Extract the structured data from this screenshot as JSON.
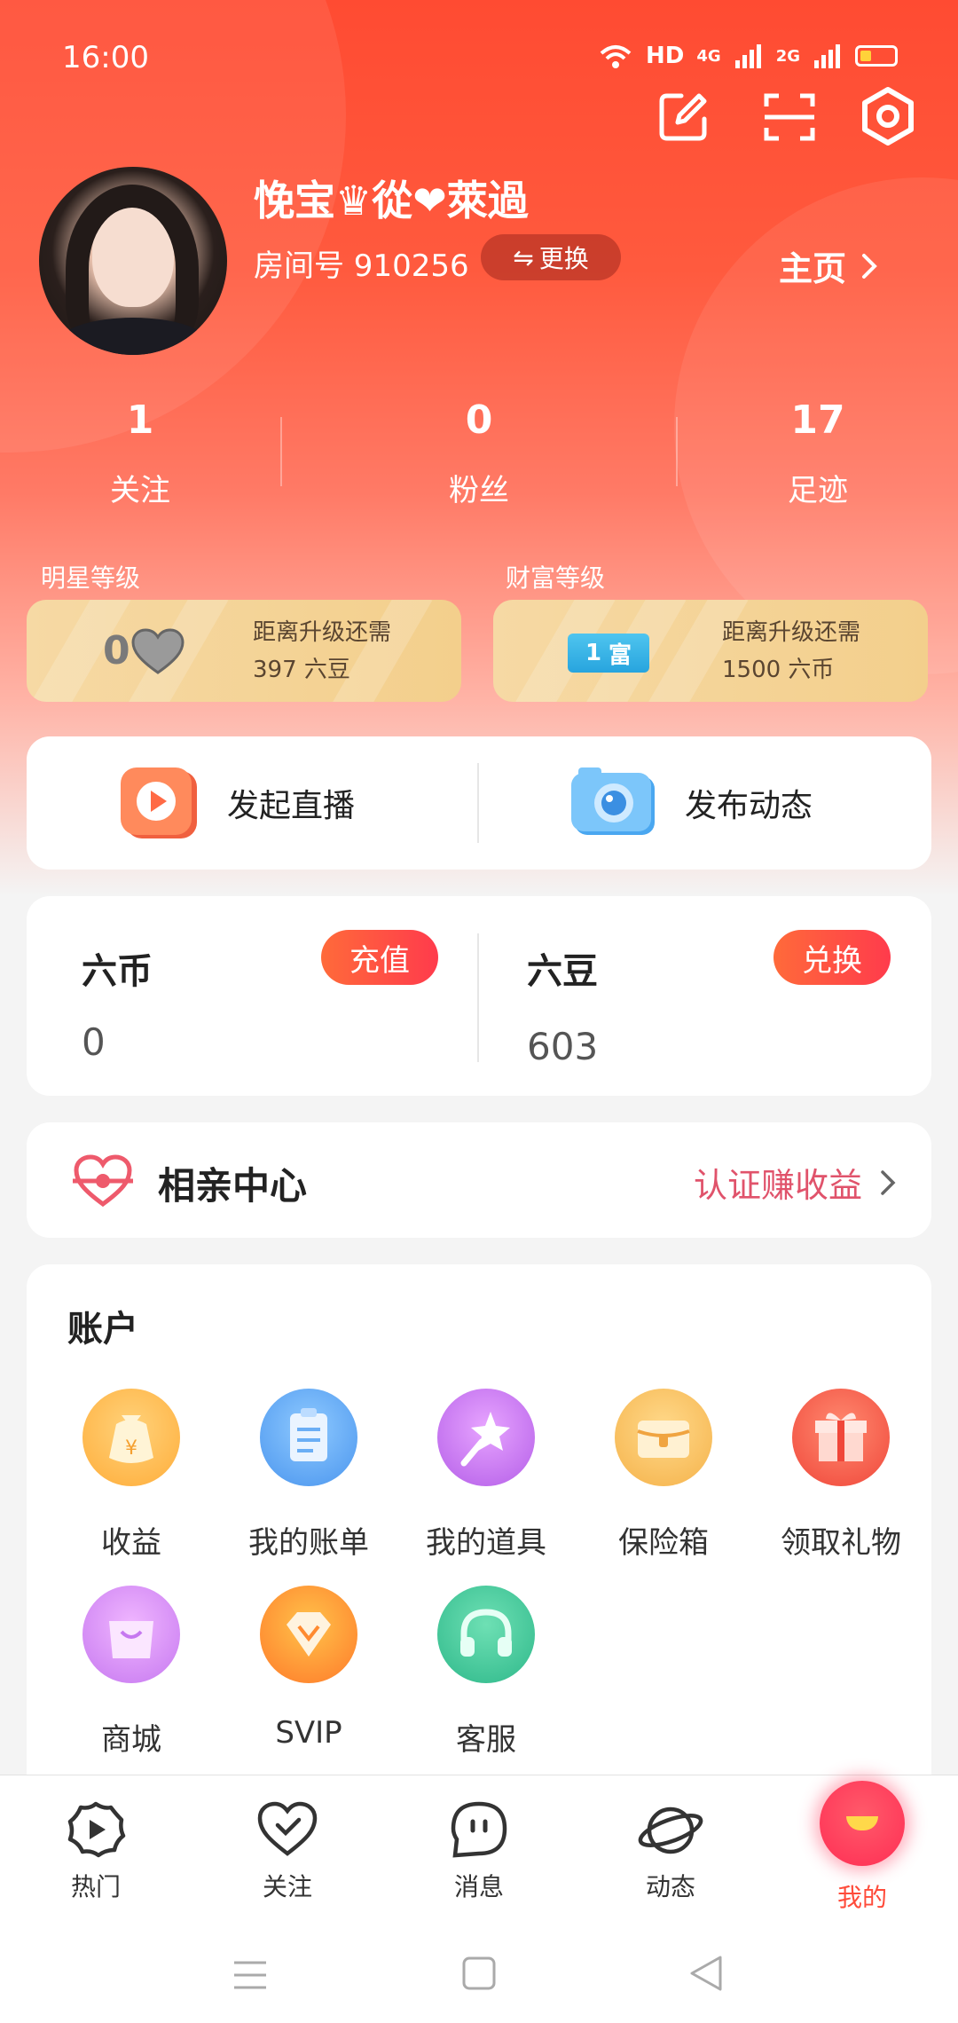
{
  "status_bar": {
    "time": "16:00",
    "hd": "HD",
    "net1": "4G",
    "net2": "2G"
  },
  "profile": {
    "username": "悗宝♛從❤萊過",
    "room_label": "房间号 910256",
    "swap_label": "更换",
    "homepage_label": "主页"
  },
  "stats": [
    {
      "value": "1",
      "label": "关注"
    },
    {
      "value": "0",
      "label": "粉丝"
    },
    {
      "value": "17",
      "label": "足迹"
    }
  ],
  "levels": {
    "star": {
      "title": "明星等级",
      "line1": "距离升级还需",
      "line2": "397 六豆",
      "badge": "0"
    },
    "wealth": {
      "title": "财富等级",
      "line1": "距离升级还需",
      "line2": "1500 六币",
      "badge_num": "1",
      "badge_text": "富"
    }
  },
  "actions": {
    "live": "发起直播",
    "post": "发布动态"
  },
  "wallet": {
    "coins": {
      "label": "六币",
      "value": "0",
      "button": "充值"
    },
    "beans": {
      "label": "六豆",
      "value": "603",
      "button": "兑换"
    }
  },
  "dating": {
    "title": "相亲中心",
    "link": "认证赚收益"
  },
  "account": {
    "title": "账户",
    "items": [
      {
        "label": "收益",
        "icon": "money-bag-icon"
      },
      {
        "label": "我的账单",
        "icon": "bill-icon"
      },
      {
        "label": "我的道具",
        "icon": "magic-wand-icon"
      },
      {
        "label": "保险箱",
        "icon": "safe-box-icon"
      },
      {
        "label": "领取礼物",
        "icon": "gift-icon"
      },
      {
        "label": "商城",
        "icon": "shopping-bag-icon"
      },
      {
        "label": "SVIP",
        "icon": "diamond-icon"
      },
      {
        "label": "客服",
        "icon": "headset-icon"
      }
    ]
  },
  "tabbar": {
    "items": [
      {
        "label": "热门"
      },
      {
        "label": "关注"
      },
      {
        "label": "消息"
      },
      {
        "label": "动态"
      },
      {
        "label": "我的"
      }
    ]
  },
  "colors": {
    "primary": "#ff4b32",
    "accent_pink": "#e0536b",
    "gold_card": "#f6d9a4"
  }
}
